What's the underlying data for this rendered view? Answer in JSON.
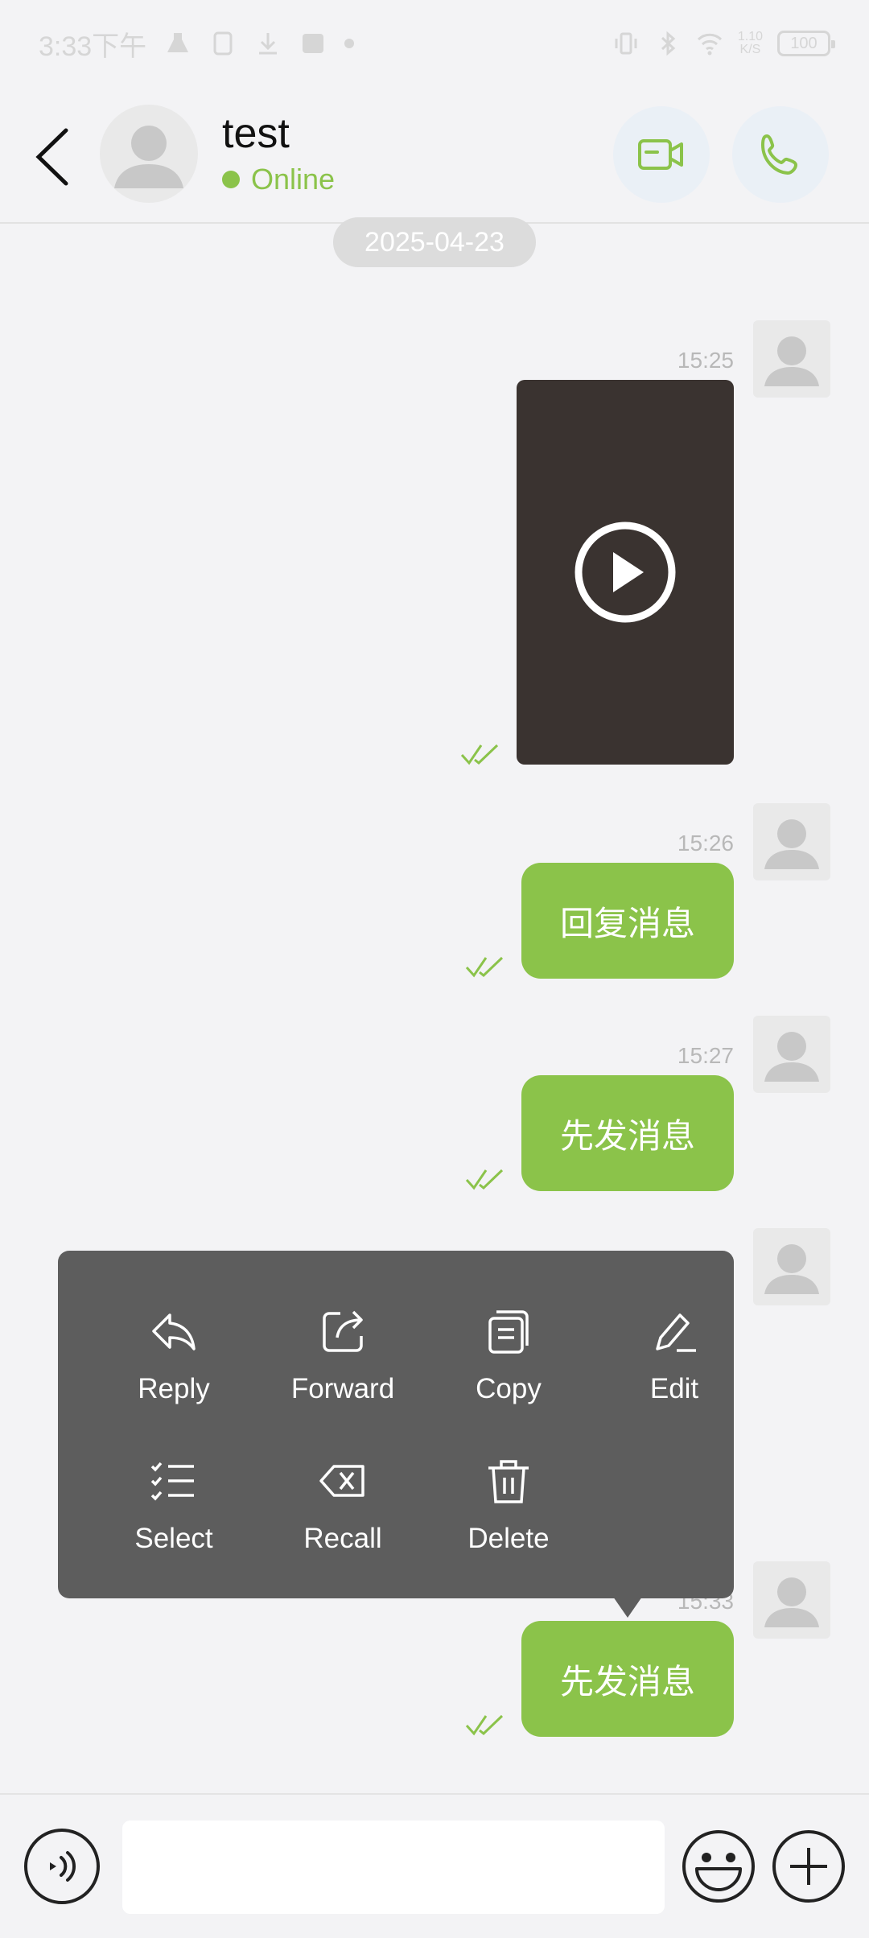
{
  "status_bar": {
    "time": "3:33下午",
    "net_speed_top": "1.10",
    "net_speed_bottom": "K/S",
    "battery": "100"
  },
  "header": {
    "contact_name": "test",
    "presence": "Online",
    "accent": "#8bc34a"
  },
  "date_chip": "2025-04-23",
  "messages": [
    {
      "time": "15:25",
      "kind": "video"
    },
    {
      "time": "15:26",
      "text": "回复消息"
    },
    {
      "time": "15:27",
      "text": "先发消息"
    },
    {
      "time": "15:33",
      "text": "先发消息"
    }
  ],
  "context_menu": {
    "items": [
      {
        "label": "Reply",
        "icon": "reply-icon"
      },
      {
        "label": "Forward",
        "icon": "forward-icon"
      },
      {
        "label": "Copy",
        "icon": "copy-icon"
      },
      {
        "label": "Edit",
        "icon": "edit-icon"
      },
      {
        "label": "Select",
        "icon": "select-icon"
      },
      {
        "label": "Recall",
        "icon": "recall-icon"
      },
      {
        "label": "Delete",
        "icon": "delete-icon"
      }
    ]
  },
  "composer": {
    "placeholder": ""
  }
}
